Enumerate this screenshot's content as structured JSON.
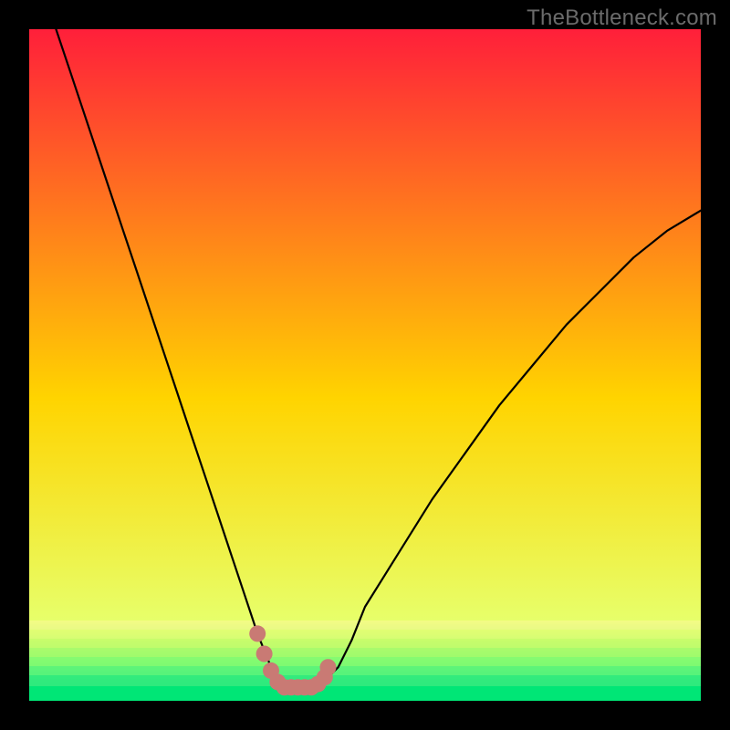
{
  "watermark": "TheBottleneck.com",
  "chart_data": {
    "type": "line",
    "title": "",
    "xlabel": "",
    "ylabel": "",
    "xlim": [
      0,
      100
    ],
    "ylim": [
      0,
      100
    ],
    "grid": false,
    "legend": false,
    "gradient": {
      "top_color": "#ff1f3a",
      "mid_color": "#ffd400",
      "bottom_band_top": "#e7ff6a",
      "bottom_band_bottom": "#00e676"
    },
    "series": [
      {
        "name": "bottleneck-curve",
        "x": [
          4,
          6,
          8,
          10,
          12,
          14,
          16,
          18,
          20,
          22,
          24,
          26,
          28,
          30,
          32,
          34,
          36,
          37,
          38,
          40,
          42,
          44,
          46,
          48,
          50,
          55,
          60,
          65,
          70,
          75,
          80,
          85,
          90,
          95,
          100
        ],
        "y": [
          100,
          94,
          88,
          82,
          76,
          70,
          64,
          58,
          52,
          46,
          40,
          34,
          28,
          22,
          16,
          10,
          5,
          3,
          2,
          2,
          2,
          3,
          5,
          9,
          14,
          22,
          30,
          37,
          44,
          50,
          56,
          61,
          66,
          70,
          73
        ]
      }
    ],
    "markers": {
      "name": "highlight-band",
      "color": "#c97a74",
      "radius_px": 9,
      "points_x": [
        34,
        35,
        36,
        37,
        38,
        39,
        40,
        41,
        42,
        43,
        44,
        44.5
      ],
      "points_y": [
        10,
        7,
        4.5,
        2.8,
        2,
        2,
        2,
        2,
        2,
        2.5,
        3.5,
        5
      ]
    }
  }
}
